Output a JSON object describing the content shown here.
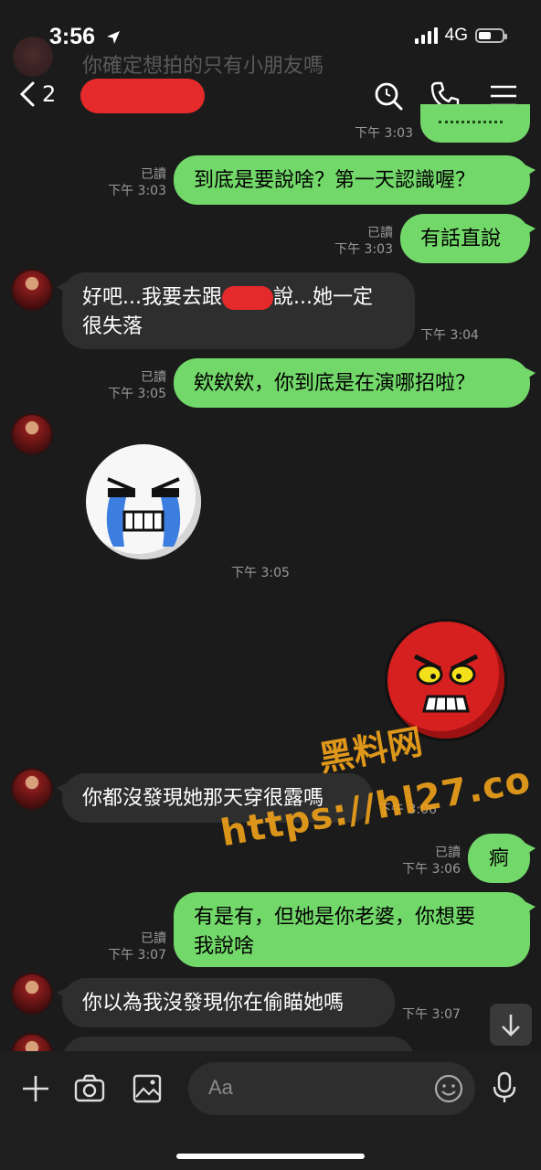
{
  "status": {
    "time": "3:56",
    "network": "4G"
  },
  "ghost_notification": "你確定想拍的只有小朋友嗎",
  "header": {
    "back_count": "2"
  },
  "messages": [
    {
      "from": "me",
      "text": "到底是要說啥？第一天認識喔？",
      "read": "已讀",
      "time": "下午 3:03"
    },
    {
      "from": "me",
      "text": "有話直說",
      "read": "已讀",
      "time": "下午 3:03"
    },
    {
      "from": "them",
      "text_a": "好吧...我要去跟",
      "text_b": "說...她一定",
      "text_c": "很失落",
      "time": "下午 3:04"
    },
    {
      "from": "me",
      "text": "欸欸欸，你到底是在演哪招啦？",
      "read": "已讀",
      "time": "下午 3:05"
    },
    {
      "from": "them",
      "sticker": "crying-face-sticker",
      "time": "下午 3:05"
    },
    {
      "from": "me",
      "sticker": "angry-red-face-sticker"
    },
    {
      "from": "them",
      "text": "你都沒發現她那天穿很露嗎",
      "time": "下午 3:06"
    },
    {
      "from": "me",
      "text": "痾",
      "read": "已讀",
      "time": "下午 3:06"
    },
    {
      "from": "me",
      "text_a": "有是有，但她是你老婆，你想要",
      "text_b": "我說啥",
      "read": "已讀",
      "time": "下午 3:07"
    },
    {
      "from": "them",
      "text": "你以為我沒發現你在偷瞄她嗎",
      "time": "下午 3:07"
    }
  ],
  "top_partial_time": "下午 3:03",
  "watermark": {
    "title": "黑料网",
    "url": "https://hl27.co"
  },
  "composer": {
    "placeholder": "Aa"
  },
  "colors": {
    "outgoing": "#73d86a",
    "incoming": "#2e2e2e",
    "background": "#1b1b1b",
    "watermark": "#f0a21a"
  }
}
